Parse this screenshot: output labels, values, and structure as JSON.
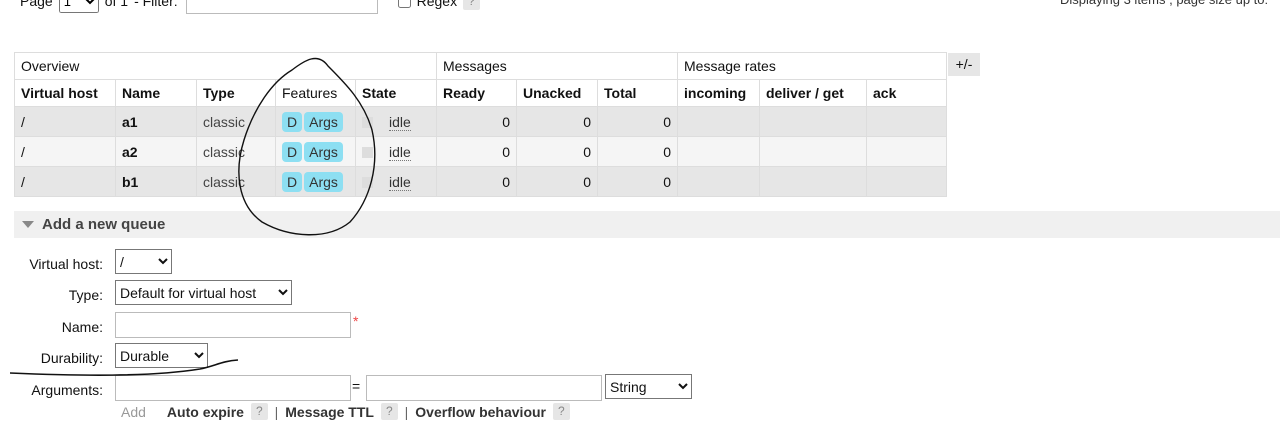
{
  "pager": {
    "page_label": "Page",
    "page_value": "1",
    "of_label": "of 1",
    "filter_label": "- Filter:",
    "filter_value": "",
    "regex_label": "Regex",
    "help": "?",
    "display_info": "Displaying 3 items , page size up to:"
  },
  "table": {
    "groups": [
      "Overview",
      "Messages",
      "Message rates"
    ],
    "columns": [
      "Virtual host",
      "Name",
      "Type",
      "Features",
      "State",
      "Ready",
      "Unacked",
      "Total",
      "incoming",
      "deliver / get",
      "ack"
    ],
    "toggle": "+/-",
    "rows": [
      {
        "vhost": "/",
        "name": "a1",
        "type": "classic",
        "features": [
          "D",
          "Args"
        ],
        "state": "idle",
        "ready": "0",
        "unacked": "0",
        "total": "0",
        "incoming": "",
        "deliver": "",
        "ack": ""
      },
      {
        "vhost": "/",
        "name": "a2",
        "type": "classic",
        "features": [
          "D",
          "Args"
        ],
        "state": "idle",
        "ready": "0",
        "unacked": "0",
        "total": "0",
        "incoming": "",
        "deliver": "",
        "ack": ""
      },
      {
        "vhost": "/",
        "name": "b1",
        "type": "classic",
        "features": [
          "D",
          "Args"
        ],
        "state": "idle",
        "ready": "0",
        "unacked": "0",
        "total": "0",
        "incoming": "",
        "deliver": "",
        "ack": ""
      }
    ]
  },
  "add_queue": {
    "title": "Add a new queue",
    "vhost_label": "Virtual host:",
    "vhost_value": "/",
    "type_label": "Type:",
    "type_value": "Default for virtual host",
    "name_label": "Name:",
    "name_value": "",
    "required_mark": "*",
    "durability_label": "Durability:",
    "durability_value": "Durable",
    "arguments_label": "Arguments:",
    "arg_equals": "=",
    "arg_type_value": "String",
    "add_label": "Add",
    "helpers": [
      "Auto expire",
      "Message TTL",
      "Overflow behaviour"
    ],
    "help": "?",
    "separator": "|"
  },
  "colors": {
    "badge": "#8ddff2",
    "row_odd": "#e6e6e6",
    "row_even": "#f5f5f5",
    "section_bg": "#f0f0f0",
    "ink": "#111111"
  }
}
